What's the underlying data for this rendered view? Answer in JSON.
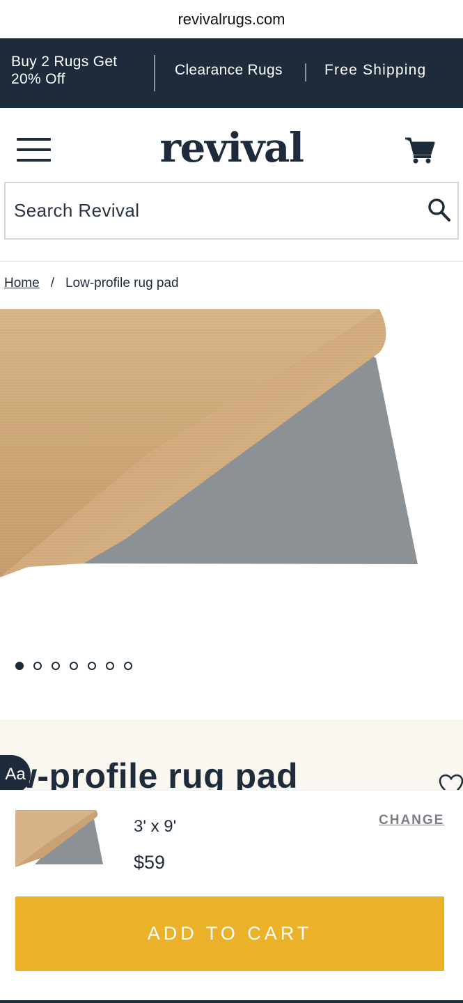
{
  "browser": {
    "url": "revivalrugs.com"
  },
  "promo_bar": {
    "offer": "Buy 2 Rugs Get 20% Off",
    "clearance": "Clearance Rugs",
    "shipping": "Free Shipping",
    "background": "#1d2b3b"
  },
  "header": {
    "logo": "revival",
    "menu_icon": "hamburger-menu-icon",
    "cart_icon": "cart-icon"
  },
  "search": {
    "placeholder": "Search Revival",
    "value": "",
    "icon": "search-icon"
  },
  "breadcrumb": {
    "home": "Home",
    "separator": "/",
    "current": "Low-profile rug pad"
  },
  "gallery": {
    "image_count": 7,
    "active_index": 0
  },
  "product": {
    "title": "w-profile rug pad",
    "accessibility_badge": "Aa"
  },
  "sticky_cart": {
    "size": "3' x 9'",
    "price": "$59",
    "change_label": "CHANGE",
    "add_to_cart_label": "ADD TO CART",
    "button_color": "#ebb129"
  }
}
